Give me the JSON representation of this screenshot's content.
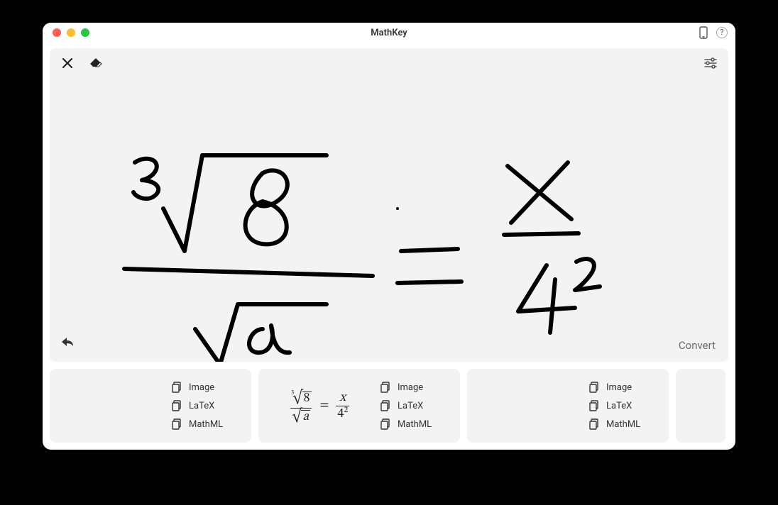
{
  "app": {
    "title": "MathKey"
  },
  "canvas": {
    "convert_label": "Convert"
  },
  "actions": {
    "image": "Image",
    "latex": "LaTeX",
    "mathml": "MathML"
  },
  "cards": [
    {
      "has_preview": false
    },
    {
      "has_preview": true,
      "formula": {
        "lhs_num_root_degree": "3",
        "lhs_num_root_radicand": "8",
        "lhs_den_root_radicand": "a",
        "eq": "=",
        "rhs_num": "x",
        "rhs_den_base": "4",
        "rhs_den_exp": "2"
      }
    },
    {
      "has_preview": false
    },
    {
      "has_preview": false,
      "partial": true
    }
  ],
  "help_symbol": "?"
}
